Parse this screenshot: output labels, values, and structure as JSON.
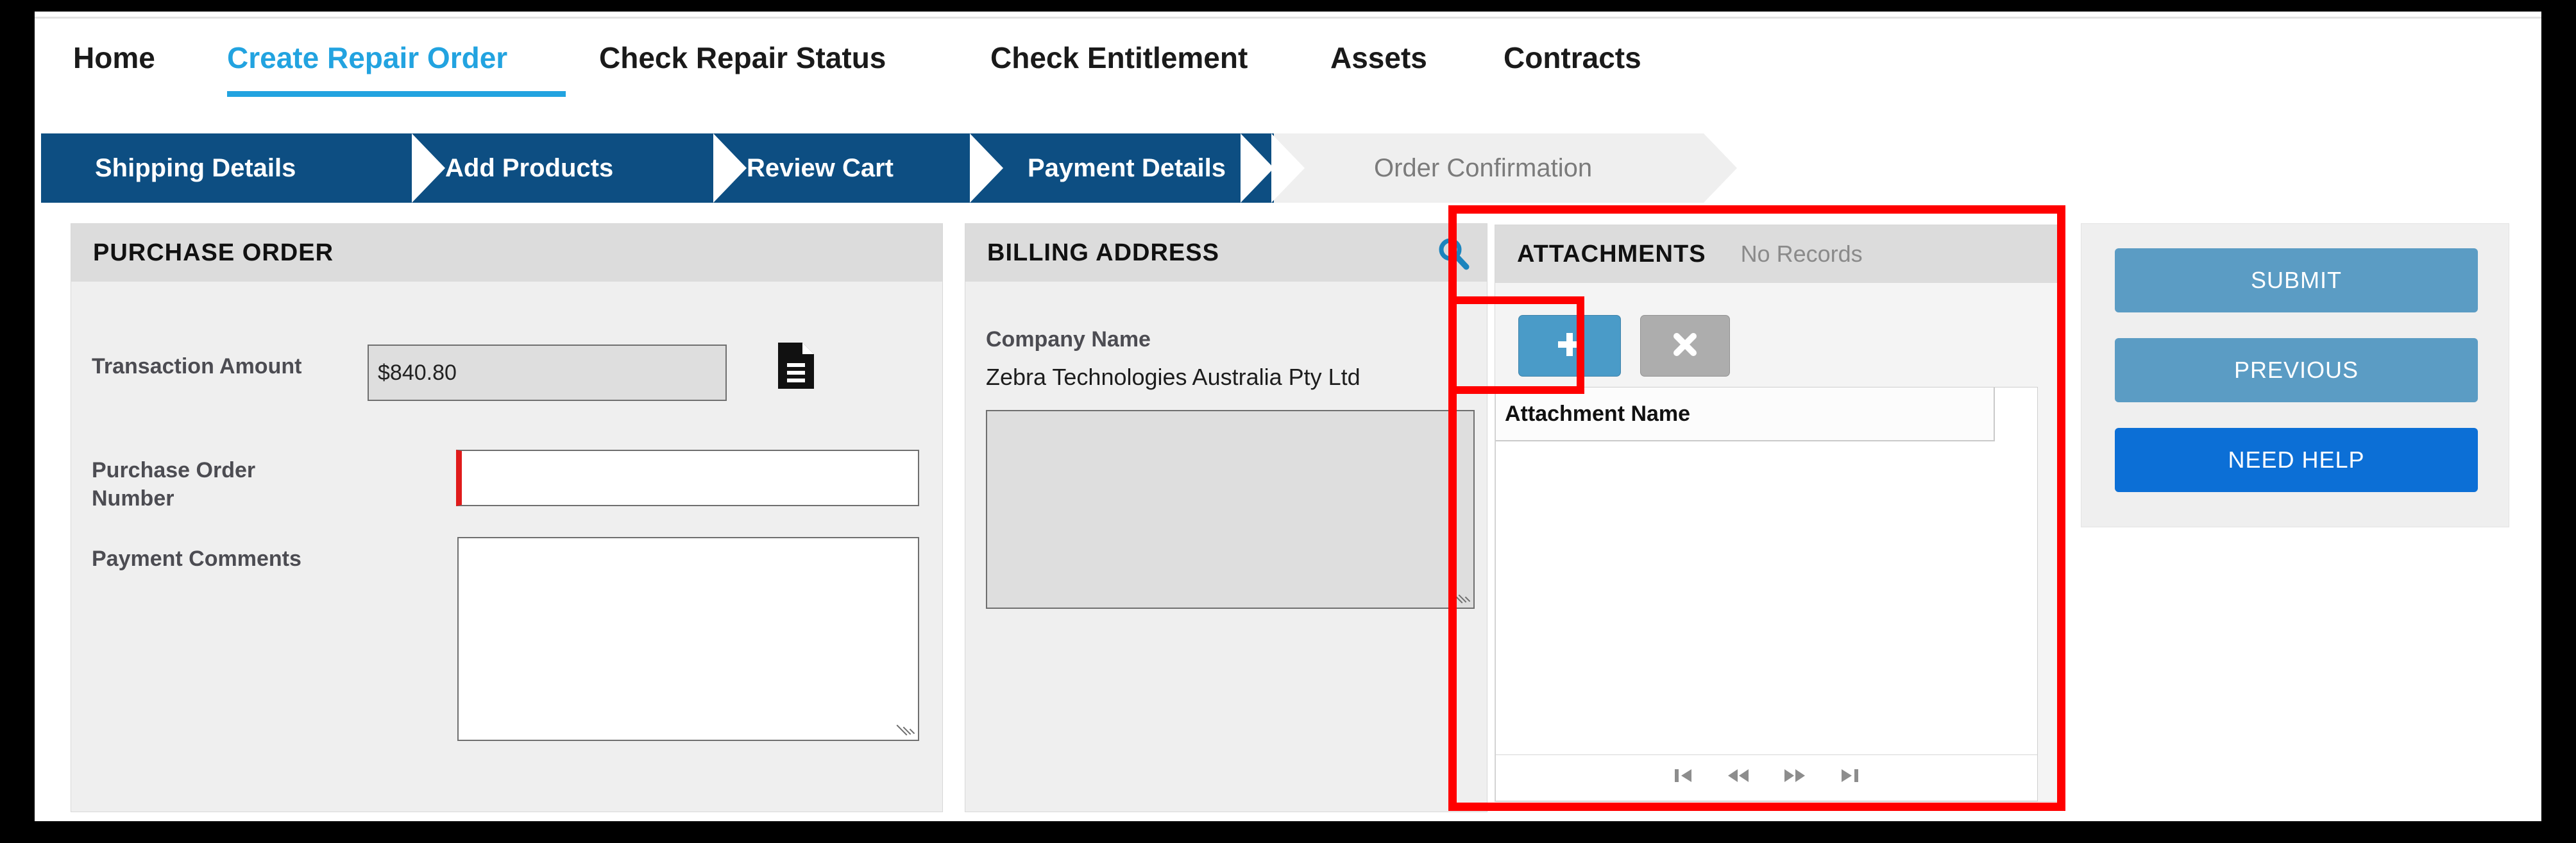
{
  "nav": {
    "items": [
      {
        "label": "Home",
        "active": false
      },
      {
        "label": "Create Repair Order",
        "active": true
      },
      {
        "label": "Check Repair Status",
        "active": false
      },
      {
        "label": "Check Entitlement",
        "active": false
      },
      {
        "label": "Assets",
        "active": false
      },
      {
        "label": "Contracts",
        "active": false
      }
    ]
  },
  "stepper": {
    "steps": [
      {
        "label": "Shipping Details",
        "state": "done"
      },
      {
        "label": "Add Products",
        "state": "done"
      },
      {
        "label": "Review Cart",
        "state": "done"
      },
      {
        "label": "Payment Details",
        "state": "current"
      },
      {
        "label": "Order Confirmation",
        "state": "upcoming"
      }
    ]
  },
  "purchase_order": {
    "title": "PURCHASE ORDER",
    "transaction_amount_label": "Transaction Amount",
    "transaction_amount_value": "$840.80",
    "document_icon": "document-icon",
    "po_number_label": "Purchase Order Number",
    "po_number_value": "",
    "po_number_placeholder": "",
    "payment_comments_label": "Payment Comments",
    "payment_comments_value": "",
    "payment_comments_placeholder": ""
  },
  "billing_address": {
    "title": "BILLING ADDRESS",
    "search_icon": "search-icon",
    "company_name_label": "Company Name",
    "company_name_value": "Zebra Technologies Australia Pty Ltd",
    "address_value": ""
  },
  "attachments": {
    "title": "ATTACHMENTS",
    "status": "No Records",
    "add_button_icon": "plus-icon",
    "delete_button_icon": "close-icon",
    "columns": [
      "Attachment Name"
    ],
    "rows": [],
    "pager": [
      {
        "icon": "first-page-icon"
      },
      {
        "icon": "previous-page-icon"
      },
      {
        "icon": "next-page-icon"
      },
      {
        "icon": "last-page-icon"
      }
    ]
  },
  "actions": {
    "submit_label": "SUBMIT",
    "previous_label": "PREVIOUS",
    "need_help_label": "NEED HELP"
  },
  "colors": {
    "accent_blue": "#22a3e0",
    "stepper_blue": "#0d4e82",
    "button_light_blue": "#5b9cc4",
    "button_strong_blue": "#0c6fd6",
    "annotation_red": "#ff0000",
    "required_red": "#e01b1b"
  }
}
